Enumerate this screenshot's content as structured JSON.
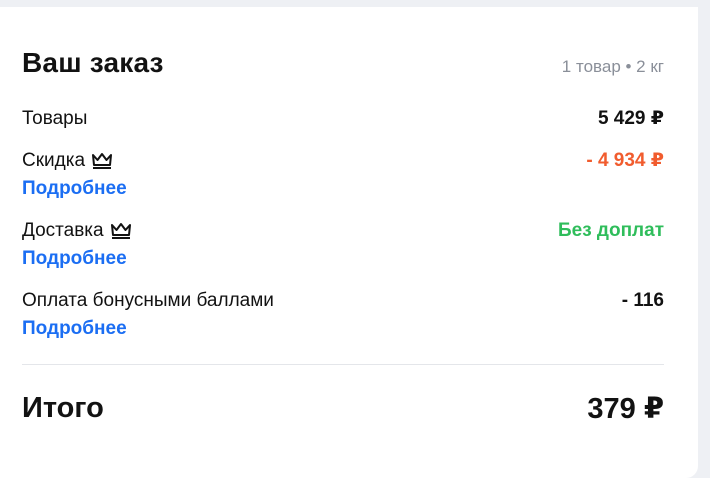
{
  "order": {
    "title": "Ваш заказ",
    "meta": "1 товар • 2 кг",
    "rows": [
      {
        "label": "Товары",
        "value": "5 429 ₽",
        "has_more": false,
        "crown": false
      },
      {
        "label": "Скидка",
        "value": "- 4 934 ₽",
        "more": "Подробнее",
        "crown": true,
        "icon": "crown-icon"
      },
      {
        "label": "Доставка",
        "value": "Без доплат",
        "more": "Подробнее",
        "crown": true,
        "icon": "crown-icon"
      },
      {
        "label": "Оплата бонусными баллами",
        "value": "- 116",
        "more": "Подробнее",
        "crown": false
      }
    ],
    "total_label": "Итого",
    "total_value": "379 ₽"
  },
  "colors": {
    "link": "#1b6ef3",
    "discount": "#f15c2e",
    "delivery": "#2fbd5b",
    "muted": "#8a8f99"
  }
}
